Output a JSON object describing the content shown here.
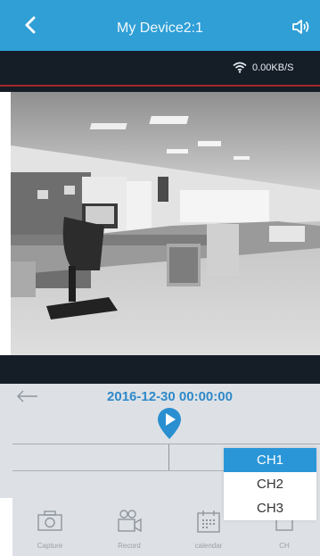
{
  "header": {
    "title": "My Device2:1",
    "back_icon": "chevron-left-icon",
    "sound_icon": "speaker-icon"
  },
  "status": {
    "speed": "0.00KB/S",
    "wifi_icon": "wifi-icon"
  },
  "playback": {
    "datetime": "2016-12-30 00:00:00",
    "back_icon": "arrow-left-icon",
    "play_icon": "play-pin-icon"
  },
  "toolbar": {
    "items": [
      {
        "label": "Capture",
        "icon": "camera-icon"
      },
      {
        "label": "Record",
        "icon": "video-camera-icon"
      },
      {
        "label": "calendar",
        "icon": "calendar-icon"
      },
      {
        "label": "CH",
        "icon": "channel-icon"
      }
    ]
  },
  "channel_menu": {
    "options": [
      "CH1",
      "CH2",
      "CH3"
    ],
    "selected": "CH1"
  },
  "colors": {
    "header": "#2f9fd6",
    "dark_bar": "#151d27",
    "accent_text": "#2f89c9",
    "selected_option": "#2a96d8"
  }
}
